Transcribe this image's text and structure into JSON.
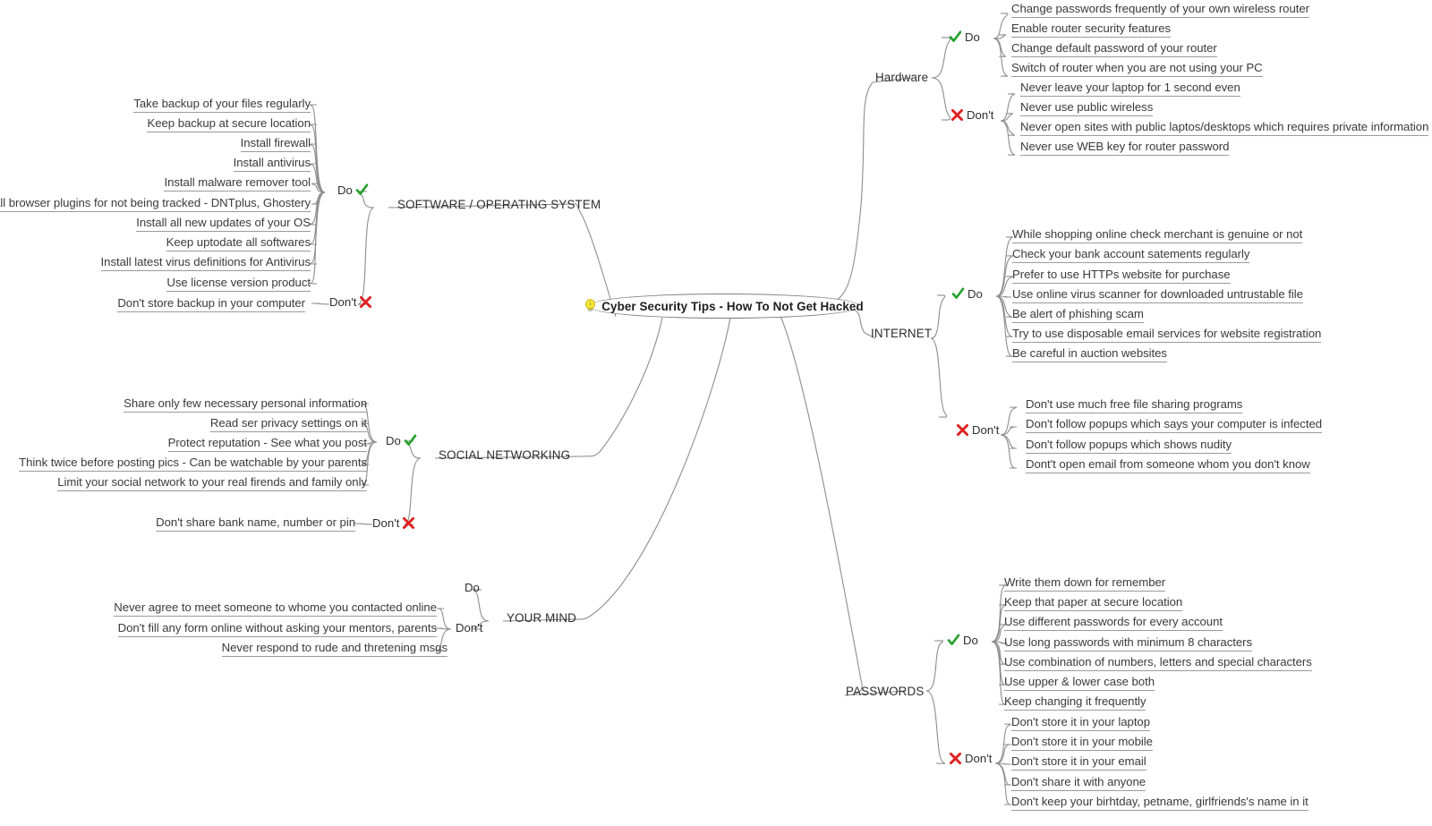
{
  "root": {
    "title": "Cyber Security Tips - How To Not Get Hacked",
    "icon": "lightbulb-icon"
  },
  "colors": {
    "check": "#22a02b",
    "cross": "#e02020",
    "wire": "#8d8d8d",
    "text": "#3a3a3a",
    "background": "#ffffff",
    "bulb": "#f2e13a"
  },
  "labels": {
    "do": "Do",
    "dont": "Don't",
    "check_icon": "green-check-icon",
    "cross_icon": "red-cross-icon"
  },
  "branches": [
    {
      "id": "hardware",
      "name": "Hardware",
      "side": "right",
      "groups": [
        {
          "label": "Do",
          "icon": "green-check-icon",
          "items": [
            "Change passwords frequently of your own wireless router",
            "Enable router security features",
            "Change default password of your router",
            "Switch of router when you are not using your PC"
          ]
        },
        {
          "label": "Don't",
          "icon": "red-cross-icon",
          "items": [
            "Never leave your laptop for 1 second even",
            "Never use public wireless",
            "Never open sites with public laptos/desktops which requires private information",
            "Never use WEB key for router password"
          ]
        }
      ]
    },
    {
      "id": "internet",
      "name": "INTERNET",
      "side": "right",
      "groups": [
        {
          "label": "Do",
          "icon": "green-check-icon",
          "items": [
            "While shopping online check merchant is genuine or not",
            "Check your bank account satements regularly",
            "Prefer to use HTTPs website for purchase",
            "Use online virus scanner for downloaded untrustable file",
            "Be alert of phishing scam",
            "Try to use disposable email services for website registration",
            "Be careful in auction websites"
          ]
        },
        {
          "label": "Don't",
          "icon": "red-cross-icon",
          "items": [
            "Don't use much free file sharing programs",
            "Don't follow popups which says your computer is infected",
            "Don't follow popups which shows nudity",
            "Dont't open email from someone whom you don't know"
          ]
        }
      ]
    },
    {
      "id": "passwords",
      "name": "PASSWORDS",
      "side": "right",
      "groups": [
        {
          "label": "Do",
          "icon": "green-check-icon",
          "items": [
            "Write them down for remember",
            "Keep that paper at secure location",
            "Use different passwords for every account",
            "Use long passwords with minimum 8 characters",
            "Use combination of numbers, letters and special characters",
            "Use upper & lower case both",
            "Keep changing it frequently"
          ]
        },
        {
          "label": "Don't",
          "icon": "red-cross-icon",
          "items": [
            "Don't store it in your laptop",
            "Don't store it in your mobile",
            "Don't store it in your email",
            "Don't share it with anyone",
            "Don't keep your birhtday, petname, girlfriends's name in it"
          ]
        }
      ]
    },
    {
      "id": "software",
      "name": "SOFTWARE / OPERATING SYSTEM",
      "side": "left",
      "groups": [
        {
          "label": "Do",
          "icon": "green-check-icon",
          "items": [
            "Take backup of your files regularly",
            "Keep backup at secure location",
            "Install firewall",
            "Install antivirus",
            "Install malware remover tool",
            "Install browser plugins for not being tracked - DNTplus, Ghostery",
            "Install all new updates of your OS",
            "Keep uptodate all softwares",
            "Install latest virus definitions for Antivirus",
            "Use license version product"
          ]
        },
        {
          "label": "Don't",
          "icon": "red-cross-icon",
          "items": [
            "Don't store backup in your computer"
          ]
        }
      ]
    },
    {
      "id": "social",
      "name": "SOCIAL NETWORKING",
      "side": "left",
      "groups": [
        {
          "label": "Do",
          "icon": "green-check-icon",
          "items": [
            "Share only few necessary personal information",
            "Read ser privacy settings on it",
            "Protect reputation - See what you post",
            "Think twice before posting pics - Can be watchable by your parents",
            "Limit your social network to your real firends and family only"
          ]
        },
        {
          "label": "Don't",
          "icon": "red-cross-icon",
          "items": [
            "Don't share bank name, number or pin"
          ]
        }
      ]
    },
    {
      "id": "yourmind",
      "name": "YOUR MIND",
      "side": "left",
      "groups": [
        {
          "label": "Do",
          "icon": "none",
          "items": []
        },
        {
          "label": "Don't",
          "icon": "none",
          "items": [
            "Never agree to meet someone to whome you contacted online",
            "Don't fill any form online without asking your mentors, parents",
            "Never respond to rude and thretening msgs"
          ]
        }
      ]
    }
  ]
}
